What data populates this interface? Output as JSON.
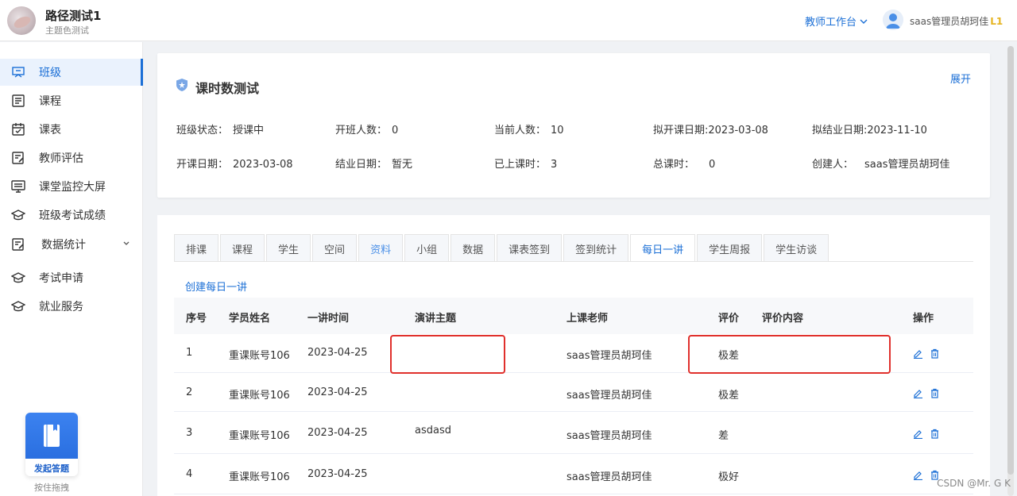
{
  "header": {
    "brand_title": "路径测试1",
    "brand_subtitle": "主题色测试",
    "workbench_label": "教师工作台",
    "user_name": "saas管理员胡珂佳",
    "user_level": "L1"
  },
  "sidebar": {
    "items": [
      {
        "label": "班级",
        "icon": "classroom-icon"
      },
      {
        "label": "课程",
        "icon": "course-icon"
      },
      {
        "label": "课表",
        "icon": "calendar-icon"
      },
      {
        "label": "教师评估",
        "icon": "evaluation-icon"
      },
      {
        "label": "课堂监控大屏",
        "icon": "monitor-icon"
      },
      {
        "label": "班级考试成绩",
        "icon": "graduation-cap-icon"
      },
      {
        "label": "数据统计",
        "icon": "statistics-icon"
      },
      {
        "label": "考试申请",
        "icon": "graduation-cap-icon"
      },
      {
        "label": "就业服务",
        "icon": "graduation-cap-icon"
      }
    ],
    "float_button_label": "发起答题",
    "drag_hint": "按住拖拽"
  },
  "info": {
    "title": "课时数测试",
    "expand_label": "展开",
    "fields": [
      {
        "key": "班级状态：",
        "value": "授课中"
      },
      {
        "key": "开班人数：",
        "value": "0"
      },
      {
        "key": "当前人数：",
        "value": "10"
      },
      {
        "key": "拟开课日期:",
        "value": "2023-03-08"
      },
      {
        "key": "拟结业日期:",
        "value": "2023-11-10"
      },
      {
        "key": "开课日期：",
        "value": "2023-03-08"
      },
      {
        "key": "结业日期：",
        "value": "暂无"
      },
      {
        "key": "已上课时：",
        "value": "3"
      },
      {
        "key": "总课时：",
        "value": "0"
      },
      {
        "key": "创建人：",
        "value": "saas管理员胡珂佳"
      }
    ]
  },
  "tabs": [
    "排课",
    "课程",
    "学生",
    "空间",
    "资料",
    "小组",
    "数据",
    "课表签到",
    "签到统计",
    "每日一讲",
    "学生周报",
    "学生访谈"
  ],
  "active_tab": "每日一讲",
  "create_link": "创建每日一讲",
  "table": {
    "headers": [
      "序号",
      "学员姓名",
      "一讲时间",
      "演讲主题",
      "上课老师",
      "评价",
      "评价内容",
      "操作"
    ],
    "rows": [
      {
        "no": "1",
        "name": "重课账号106",
        "date": "2023-04-25",
        "topic": "",
        "teacher": "saas管理员胡珂佳",
        "rating": "极差",
        "comment": ""
      },
      {
        "no": "2",
        "name": "重课账号106",
        "date": "2023-04-25",
        "topic": "",
        "teacher": "saas管理员胡珂佳",
        "rating": "极差",
        "comment": ""
      },
      {
        "no": "3",
        "name": "重课账号106",
        "date": "2023-04-25",
        "topic": "asdasd",
        "teacher": "saas管理员胡珂佳",
        "rating": "差",
        "comment": ""
      },
      {
        "no": "4",
        "name": "重课账号106",
        "date": "2023-04-25",
        "topic": "",
        "teacher": "saas管理员胡珂佳",
        "rating": "极好",
        "comment": ""
      }
    ]
  },
  "watermark": "CSDN @Mr. G K",
  "colors": {
    "accent": "#1b6fd6",
    "highlight_box": "#e0302c"
  }
}
